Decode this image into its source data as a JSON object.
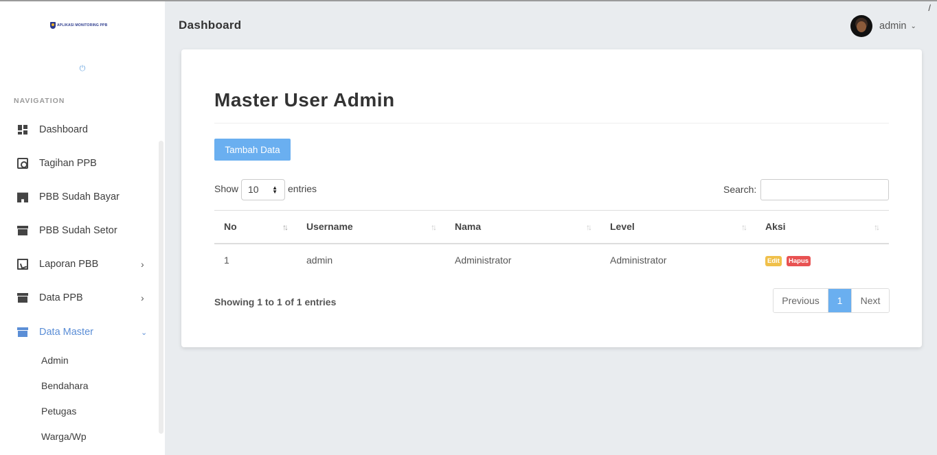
{
  "app": {
    "logo_text": "APLIKASI MONITORING PPB",
    "nav_heading": "NAVIGATION"
  },
  "sidebar": {
    "items": [
      {
        "label": "Dashboard",
        "icon": "dashboard-icon"
      },
      {
        "label": "Tagihan PPB",
        "icon": "camera-box-icon"
      },
      {
        "label": "PBB Sudah Bayar",
        "icon": "building-icon"
      },
      {
        "label": "PBB Sudah Setor",
        "icon": "archive-icon"
      },
      {
        "label": "Laporan PBB",
        "icon": "pdf-file-icon"
      },
      {
        "label": "Data PPB",
        "icon": "archive-icon"
      },
      {
        "label": "Data Master",
        "icon": "archive-icon"
      }
    ],
    "subitems": [
      "Admin",
      "Bendahara",
      "Petugas",
      "Warga/Wp"
    ]
  },
  "header": {
    "title": "Dashboard",
    "user_name": "admin",
    "corner_mark": "/"
  },
  "main": {
    "title": "Master User Admin",
    "add_button": "Tambah Data",
    "show_label": "Show",
    "page_size": "10",
    "entries_label": "entries",
    "search_label": "Search:",
    "search_value": "",
    "columns": [
      "No",
      "Username",
      "Nama",
      "Level",
      "Aksi"
    ],
    "rows": [
      {
        "no": "1",
        "username": "admin",
        "nama": "Administrator",
        "level": "Administrator",
        "edit": "Edit",
        "hapus": "Hapus"
      }
    ],
    "info": "Showing 1 to 1 of 1 entries",
    "pagination": {
      "previous": "Previous",
      "current": "1",
      "next": "Next"
    }
  },
  "colors": {
    "accent": "#6aaff0",
    "active_nav": "#5b8ed6",
    "edit_badge": "#f0c04a",
    "delete_badge": "#e85252"
  }
}
